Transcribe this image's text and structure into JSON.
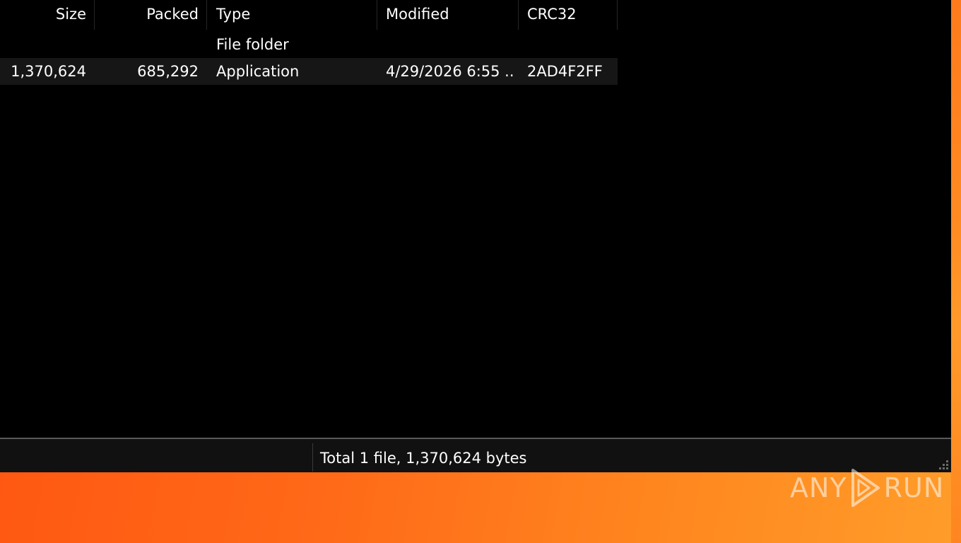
{
  "columns": [
    {
      "label": "Size"
    },
    {
      "label": "Packed"
    },
    {
      "label": "Type"
    },
    {
      "label": "Modified"
    },
    {
      "label": "CRC32"
    }
  ],
  "rows": [
    {
      "size": "",
      "packed": "",
      "type": "File folder",
      "modified": "",
      "crc": ""
    },
    {
      "size": "1,370,624",
      "packed": "685,292",
      "type": "Application",
      "modified": "4/29/2026 6:55 ...",
      "crc": "2AD4F2FF"
    }
  ],
  "status": {
    "text": "Total 1 file, 1,370,624 bytes"
  },
  "watermark": {
    "left": "ANY",
    "right": "RUN"
  },
  "colors": {
    "window_bg": "#000000",
    "row_alt_bg": "#161616",
    "status_bg": "#111111",
    "desktop_orange": "#ff6a18"
  },
  "icons": {
    "resize_grip": "resize-grip-icon",
    "watermark_play": "play-icon"
  }
}
